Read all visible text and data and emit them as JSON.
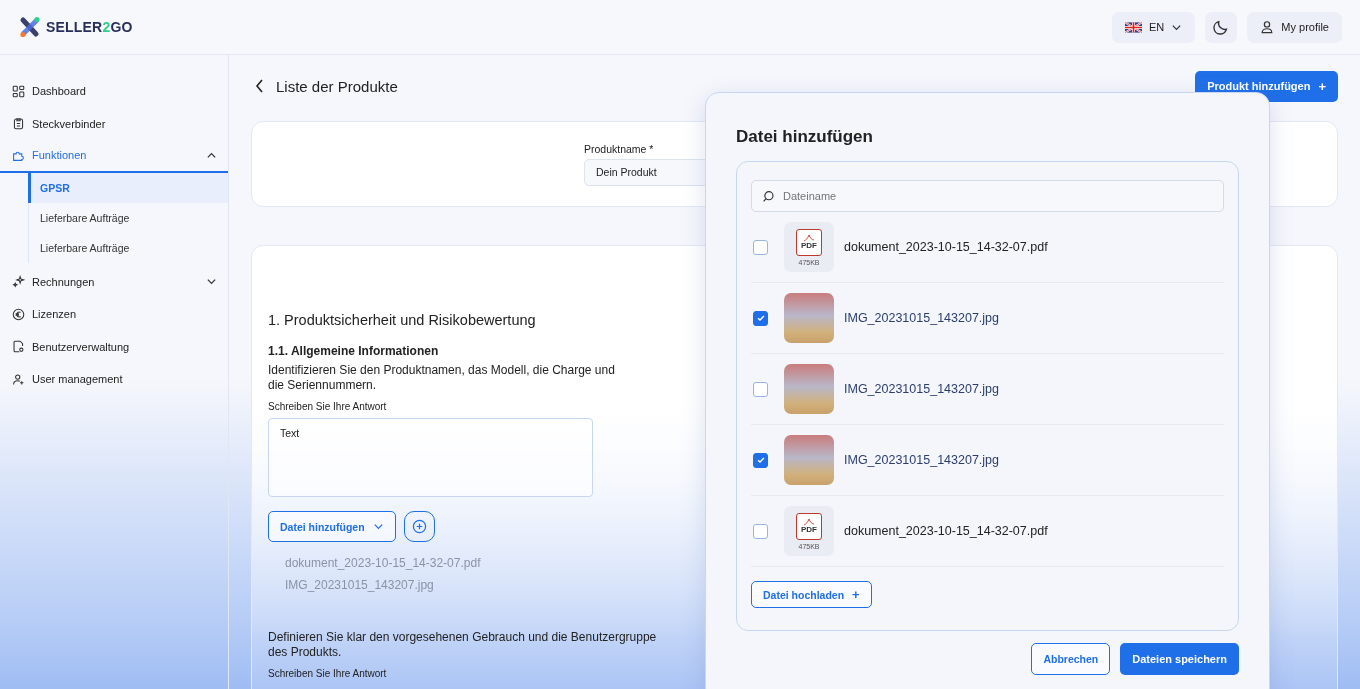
{
  "header": {
    "logo": {
      "start": "SELLER",
      "accent": "2",
      "end": "GO"
    },
    "language": {
      "code": "EN"
    },
    "profile": {
      "label": "My profile"
    }
  },
  "sidebar": {
    "items": [
      {
        "label": "Dashboard",
        "kind": "grid",
        "selected": false
      },
      {
        "label": "Steckverbinder",
        "kind": "clipboard",
        "selected": false
      },
      {
        "label": "Funktionen",
        "kind": "puzzle",
        "selected": true,
        "expanded": true,
        "children": [
          {
            "label": "GPSR",
            "selected": true
          },
          {
            "label": "Lieferbare Aufträge",
            "selected": false
          },
          {
            "label": "Lieferbare Aufträge",
            "selected": false
          }
        ]
      },
      {
        "label": "Rechnungen",
        "kind": "sparkle",
        "selected": false,
        "expanded": false
      },
      {
        "label": "Lizenzen",
        "kind": "euro",
        "selected": false
      },
      {
        "label": "Benutzerverwaltung",
        "kind": "document",
        "selected": false
      },
      {
        "label": "User management",
        "kind": "user",
        "selected": false
      }
    ]
  },
  "page": {
    "title": "Liste der Produkte",
    "add_button": "Produkt hinzufügen",
    "add_icon": "+"
  },
  "product_form": {
    "label": "Produktname *",
    "value": "Dein Produkt"
  },
  "section": {
    "heading": "1. Produktsicherheit und Risikobewertung",
    "subheading": "1.1. Allgemeine Informationen",
    "question": "Identifizieren Sie den Produktnamen, das Modell, die Charge und die Seriennummern.",
    "answer_label": "Schreiben Sie Ihre Antwort",
    "answer_value": "Text",
    "file_button": "Datei hinzufügen",
    "attached_files": [
      "dokument_2023-10-15_14-32-07.pdf",
      "IMG_20231015_143207.jpg"
    ],
    "question_2": "Definieren Sie klar den vorgesehenen Gebrauch und die Benutzergruppe des Produkts.",
    "answer_label_2": "Schreiben Sie Ihre Antwort"
  },
  "modal": {
    "title": "Datei hinzufügen",
    "search": {
      "placeholder": "Dateiname"
    },
    "files": [
      {
        "kind": "pdf",
        "name": "dokument_2023-10-15_14-32-07.pdf",
        "size": "475KB",
        "badge": "PDF",
        "checked": false
      },
      {
        "kind": "image",
        "name": "IMG_20231015_143207.jpg",
        "checked": true
      },
      {
        "kind": "image",
        "name": "IMG_20231015_143207.jpg",
        "checked": false
      },
      {
        "kind": "image",
        "name": "IMG_20231015_143207.jpg",
        "checked": true
      },
      {
        "kind": "pdf",
        "name": "dokument_2023-10-15_14-32-07.pdf",
        "size": "475KB",
        "badge": "PDF",
        "checked": false
      }
    ],
    "upload_button": "Datei hochladen",
    "upload_icon": "+",
    "cancel_button": "Abbrechen",
    "save_button": "Dateien speichern"
  }
}
